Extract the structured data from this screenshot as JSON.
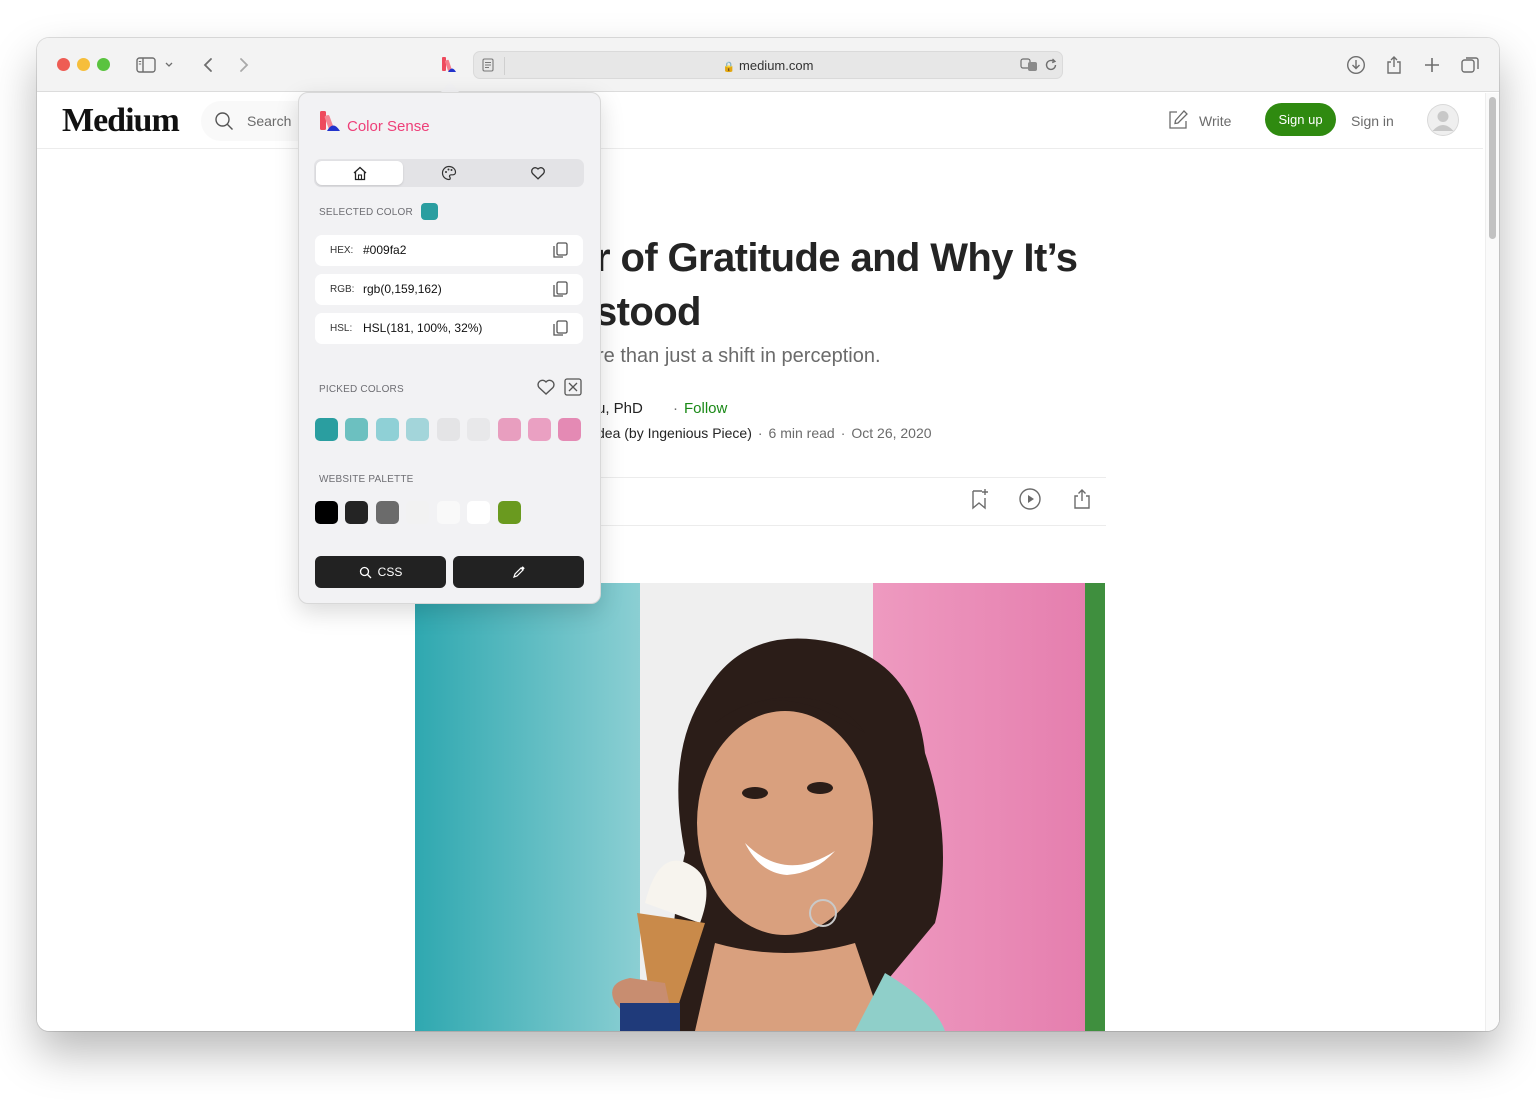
{
  "browser": {
    "url": "medium.com",
    "icons": [
      "sidebar-icon",
      "chevron-down-icon",
      "back-icon",
      "forward-icon",
      "color-sense-extension-icon",
      "reader-icon",
      "translate-icon",
      "reload-icon",
      "download-icon",
      "share-icon",
      "plus-icon",
      "tabs-icon"
    ]
  },
  "medium": {
    "logo": "Medium",
    "search_label": "Search",
    "write_label": "Write",
    "signup_label": "Sign up",
    "signin_label": "Sign in",
    "title_line1": "r of Gratitude and Why It’s",
    "title_line2": "stood",
    "subtitle": "re than just a shift in perception.",
    "author_fragment": "u, PhD",
    "follow_label": "Follow",
    "publication_fragment": "dea (by Ingenious Piece)",
    "read_time": "6 min read",
    "date": "Oct 26, 2020",
    "accent": "#2f8a10"
  },
  "popup": {
    "app_name": "Color Sense",
    "tabs": [
      "home",
      "palette",
      "favorites"
    ],
    "selected_color_label": "SELECTED COLOR",
    "selected_color": "#2a9ea0",
    "hex_key": "HEX:",
    "hex_val": "#009fa2",
    "rgb_key": "RGB:",
    "rgb_val": "rgb(0,159,162)",
    "hsl_key": "HSL:",
    "hsl_val": "HSL(181, 100%, 32%)",
    "picked_colors_label": "PICKED COLORS",
    "picked_colors": [
      "#2a9ea0",
      "#6cc0c0",
      "#8fd0d6",
      "#a3d5da",
      "#e4e4e6",
      "#e8e8ea",
      "#e89ebf",
      "#eaa0c2",
      "#e48ab4"
    ],
    "website_palette_label": "WEBSITE PALETTE",
    "website_palette": [
      "#000000",
      "#242424",
      "#6b6b6b",
      "#f2f2f2",
      "#f9f9f9",
      "#ffffff",
      "#6a9a1f"
    ],
    "css_button_label": "CSS"
  }
}
